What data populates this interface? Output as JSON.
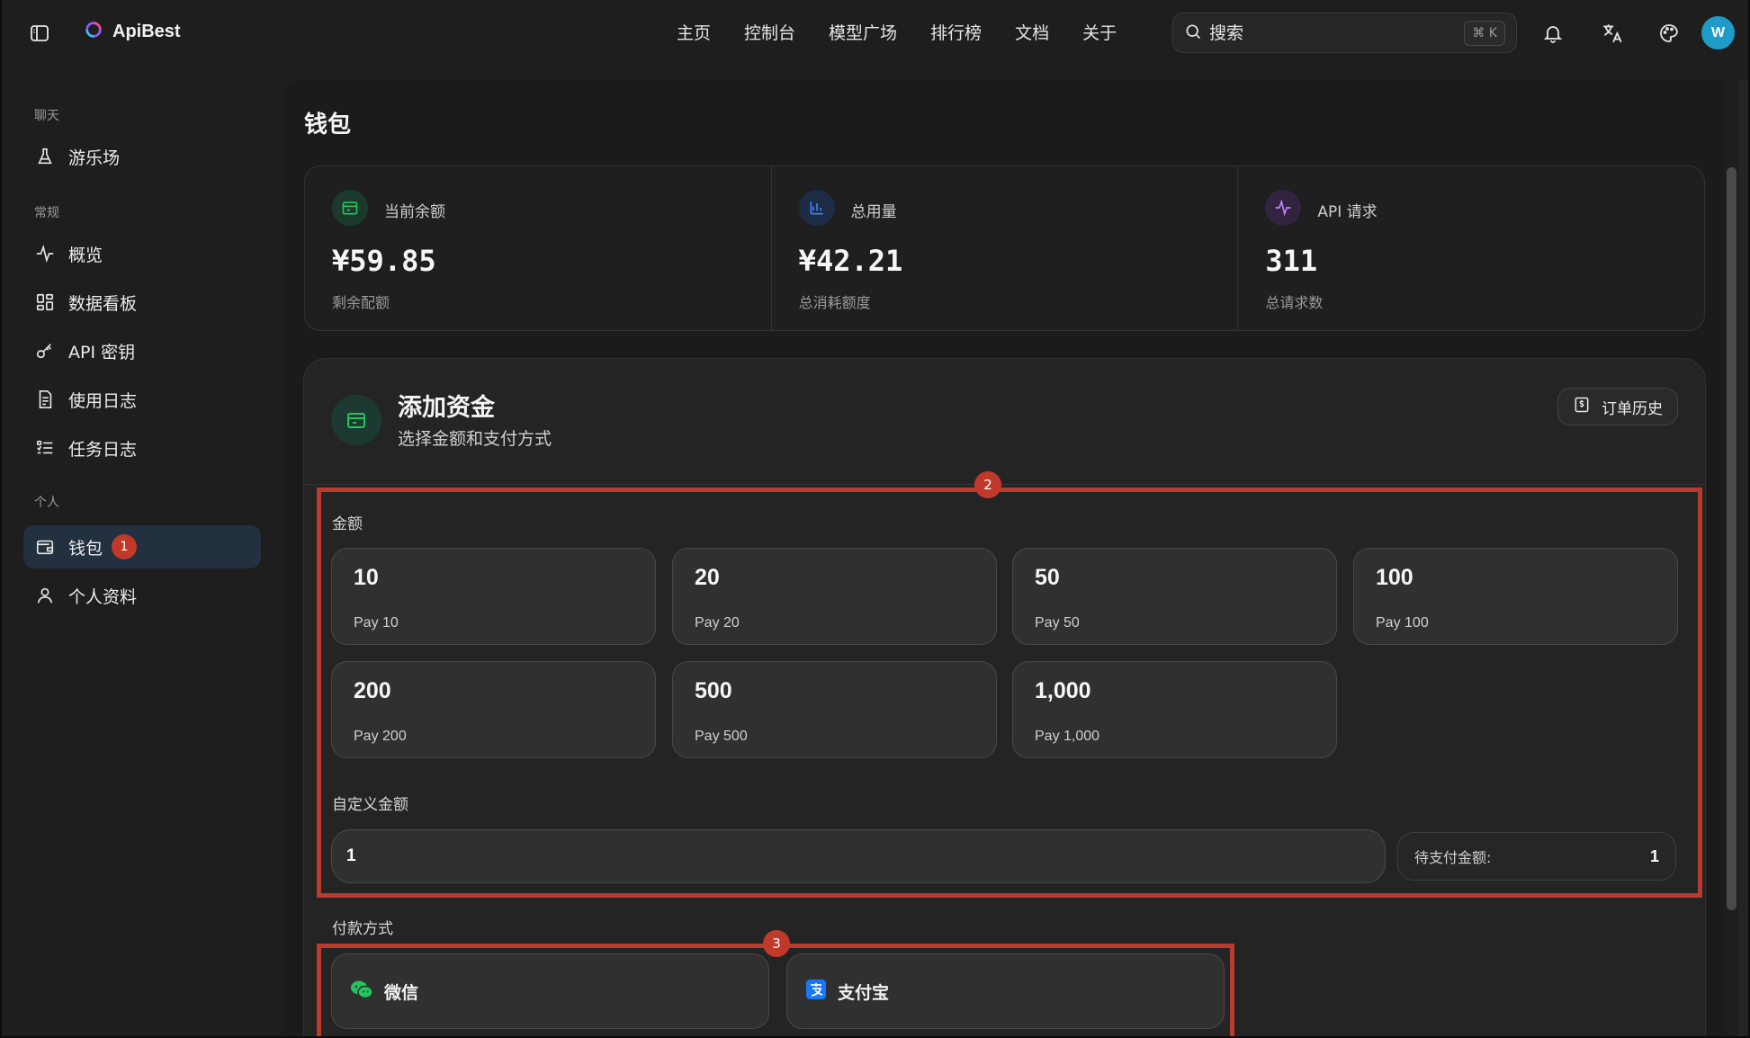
{
  "header": {
    "brand": "ApiBest",
    "nav": [
      "主页",
      "控制台",
      "模型广场",
      "排行榜",
      "文档",
      "关于"
    ],
    "search_placeholder": "搜索",
    "search_shortcut": "⌘ K",
    "avatar_letter": "W"
  },
  "sidebar": {
    "sections": [
      {
        "label": "聊天",
        "items": [
          {
            "label": "游乐场",
            "icon": "flask-icon"
          }
        ]
      },
      {
        "label": "常规",
        "items": [
          {
            "label": "概览",
            "icon": "activity-icon"
          },
          {
            "label": "数据看板",
            "icon": "dashboard-icon"
          },
          {
            "label": "API 密钥",
            "icon": "key-icon"
          },
          {
            "label": "使用日志",
            "icon": "document-icon"
          },
          {
            "label": "任务日志",
            "icon": "list-icon"
          }
        ]
      },
      {
        "label": "个人",
        "items": [
          {
            "label": "钱包",
            "icon": "wallet-icon",
            "badge": "1"
          },
          {
            "label": "个人资料",
            "icon": "user-icon"
          }
        ]
      }
    ]
  },
  "page": {
    "title": "钱包",
    "stats": [
      {
        "label": "当前余额",
        "value": "¥59.85",
        "sub": "剩余配额",
        "color": "#22c55e"
      },
      {
        "label": "总用量",
        "value": "¥42.21",
        "sub": "总消耗额度",
        "color": "#3b82f6"
      },
      {
        "label": "API 请求",
        "value": "311",
        "sub": "总请求数",
        "color": "#c084fc"
      }
    ],
    "fund": {
      "title": "添加资金",
      "subtitle": "选择金额和支付方式",
      "order_history": "订单历史",
      "amount_label": "金额",
      "amounts": [
        {
          "value": "10",
          "pay": "Pay 10"
        },
        {
          "value": "20",
          "pay": "Pay 20"
        },
        {
          "value": "50",
          "pay": "Pay 50"
        },
        {
          "value": "100",
          "pay": "Pay 100"
        },
        {
          "value": "200",
          "pay": "Pay 200"
        },
        {
          "value": "500",
          "pay": "Pay 500"
        },
        {
          "value": "1,000",
          "pay": "Pay 1,000"
        }
      ],
      "custom_label": "自定义金额",
      "custom_value": "1",
      "pending_label": "待支付金额:",
      "pending_value": "1",
      "payment_label": "付款方式",
      "payments": [
        {
          "label": "微信",
          "icon": "wechat-icon",
          "color": "#22c55e"
        },
        {
          "label": "支付宝",
          "icon": "alipay-icon",
          "color": "#1677ff"
        }
      ]
    },
    "markers": [
      "2",
      "3"
    ]
  }
}
